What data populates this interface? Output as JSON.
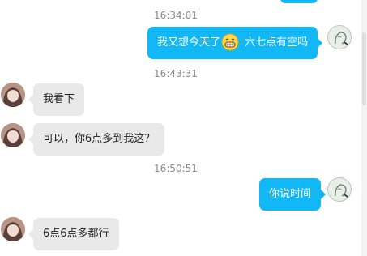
{
  "timestamps": [
    "16:34:01",
    "16:43:31",
    "16:50:51"
  ],
  "messages": [
    {
      "side": "right",
      "text_before": "我又想今天了",
      "emoji": "grin-emoji",
      "text_after": " 六七点有空吗"
    },
    {
      "side": "left",
      "text": "我看下"
    },
    {
      "side": "left",
      "text": "可以，你6点多到我这？"
    },
    {
      "side": "right",
      "text": "你说时间"
    },
    {
      "side": "left",
      "text": "6点6点多都行"
    }
  ],
  "colors": {
    "incoming_bubble": "#e9e9e9",
    "outgoing_bubble": "#12b7f5",
    "timestamp_text": "#8a8a8a",
    "background": "#ffffff"
  },
  "icons": {
    "contact_avatar": "girl-avatar-icon",
    "self_avatar": "sketch-avatar-icon",
    "emoji": "grin-emoji-icon"
  }
}
